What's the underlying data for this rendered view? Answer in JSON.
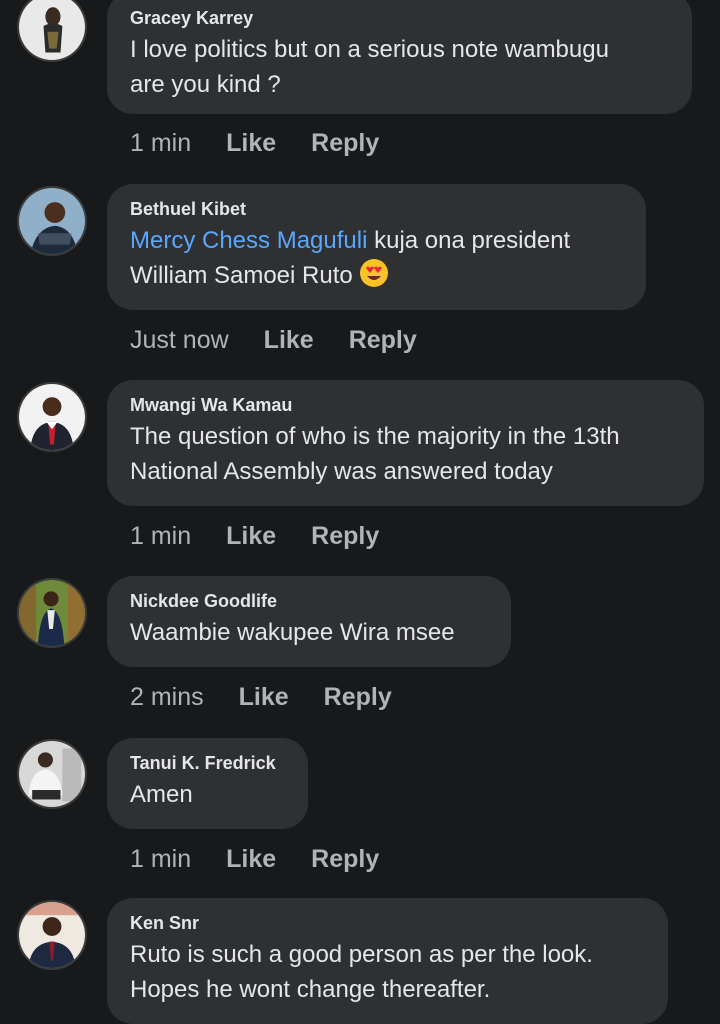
{
  "comments": [
    {
      "author": "Gracey Karrey",
      "text": "I love politics but on a serious note wambugu\nare you kind ?",
      "time": "1 min",
      "like": "Like",
      "reply": "Reply"
    },
    {
      "author": "Bethuel Kibet",
      "mention": "Mercy Chess Magufuli",
      "text": " kuja ona president\nWilliam Samoei Ruto ",
      "emoji": "heart-eyes-emoji",
      "time": "Just now",
      "like": "Like",
      "reply": "Reply"
    },
    {
      "author": "Mwangi Wa Kamau",
      "text": "The question of who is the majority in the 13th\nNational Assembly was answered today",
      "time": "1 min",
      "like": "Like",
      "reply": "Reply"
    },
    {
      "author": "Nickdee Goodlife",
      "text": "Waambie wakupee Wira msee",
      "time": "2 mins",
      "like": "Like",
      "reply": "Reply"
    },
    {
      "author": "Tanui K. Fredrick",
      "text": "Amen",
      "time": "1 min",
      "like": "Like",
      "reply": "Reply"
    },
    {
      "author": "Ken Snr",
      "text": "Ruto is such a good person as per the look.\nHopes he wont change thereafter.",
      "time": "",
      "like": "",
      "reply": ""
    }
  ],
  "colors": {
    "background": "#18191a",
    "bubble": "#2f3031",
    "text": "#e4e6eb",
    "secondary": "#b0b3b8",
    "mention": "#5aa7ff"
  }
}
